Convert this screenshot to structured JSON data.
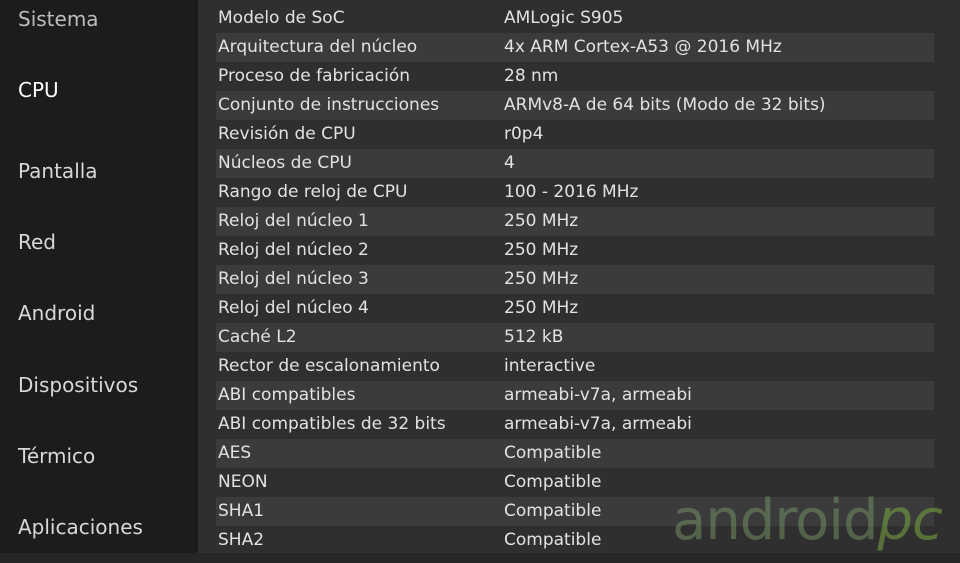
{
  "sidebar": {
    "items": [
      {
        "label": "Sistema"
      },
      {
        "label": "CPU"
      },
      {
        "label": "Pantalla"
      },
      {
        "label": "Red"
      },
      {
        "label": "Android"
      },
      {
        "label": "Dispositivos"
      },
      {
        "label": "Térmico"
      },
      {
        "label": "Aplicaciones"
      }
    ],
    "active": "CPU"
  },
  "rows": [
    {
      "key": "Modelo de SoC",
      "value": "AMLogic S905"
    },
    {
      "key": "Arquitectura del núcleo",
      "value": "4x ARM Cortex-A53 @ 2016 MHz"
    },
    {
      "key": "Proceso de fabricación",
      "value": "28 nm"
    },
    {
      "key": "Conjunto de instrucciones",
      "value": "ARMv8-A de 64 bits (Modo de 32 bits)"
    },
    {
      "key": "Revisión de CPU",
      "value": "r0p4"
    },
    {
      "key": "Núcleos de CPU",
      "value": "4"
    },
    {
      "key": "Rango de reloj de CPU",
      "value": "100 - 2016 MHz"
    },
    {
      "key": "Reloj del núcleo 1",
      "value": "250 MHz"
    },
    {
      "key": "Reloj del núcleo 2",
      "value": "250 MHz"
    },
    {
      "key": "Reloj del núcleo 3",
      "value": "250 MHz"
    },
    {
      "key": "Reloj del núcleo 4",
      "value": "250 MHz"
    },
    {
      "key": "Caché L2",
      "value": "512 kB"
    },
    {
      "key": "Rector de escalonamiento",
      "value": "interactive"
    },
    {
      "key": "ABI compatibles",
      "value": "armeabi-v7a, armeabi"
    },
    {
      "key": "ABI compatibles de 32 bits",
      "value": "armeabi-v7a, armeabi"
    },
    {
      "key": "AES",
      "value": "Compatible"
    },
    {
      "key": "NEON",
      "value": "Compatible"
    },
    {
      "key": "SHA1",
      "value": "Compatible"
    },
    {
      "key": "SHA2",
      "value": "Compatible"
    }
  ],
  "watermark": {
    "main": "android",
    "accent": "pc"
  },
  "colors": {
    "sidebar_bg": "#1c1c1c",
    "content_bg": "#2f2f2f",
    "row_alt_bg": "#3b3b3b",
    "text": "#e2e2e2",
    "watermark_green": "#88c244"
  }
}
